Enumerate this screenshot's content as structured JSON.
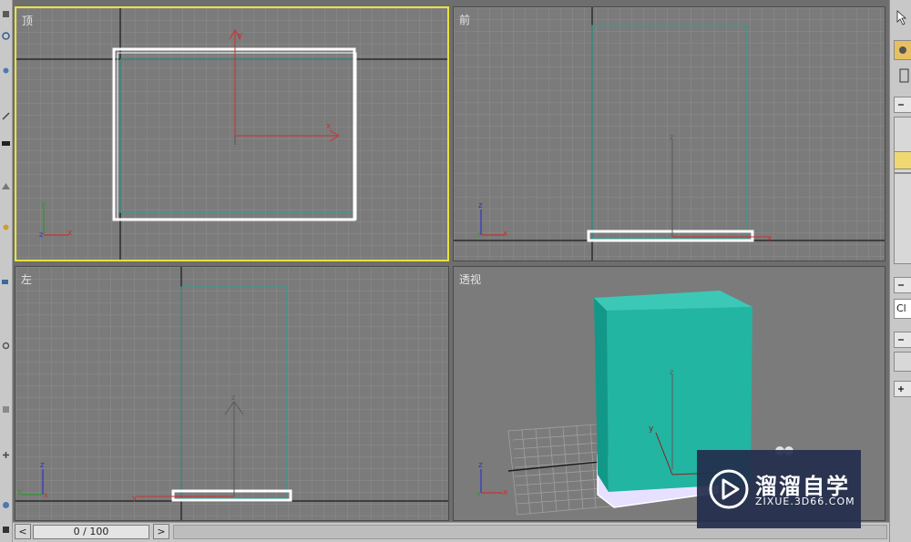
{
  "viewports": {
    "top": {
      "label": "顶"
    },
    "front": {
      "label": "前"
    },
    "left": {
      "label": "左"
    },
    "perspective": {
      "label": "透视"
    }
  },
  "axes": {
    "x": "x",
    "y": "y",
    "z": "z"
  },
  "time_slider": {
    "value": "0 / 100",
    "prev_label": "<",
    "next_label": ">"
  },
  "watermark": {
    "title": "溜溜自学",
    "url": "ZIXUE.3D66.COM"
  },
  "command_panel": {
    "box_text": "Cl"
  },
  "colors": {
    "active_border": "#e8e040",
    "viewport_bg": "#7b7b7b",
    "object_teal": "#20b0a0",
    "axis_red": "#c83232",
    "axis_green": "#2e9a2e",
    "axis_blue": "#3232c8"
  }
}
